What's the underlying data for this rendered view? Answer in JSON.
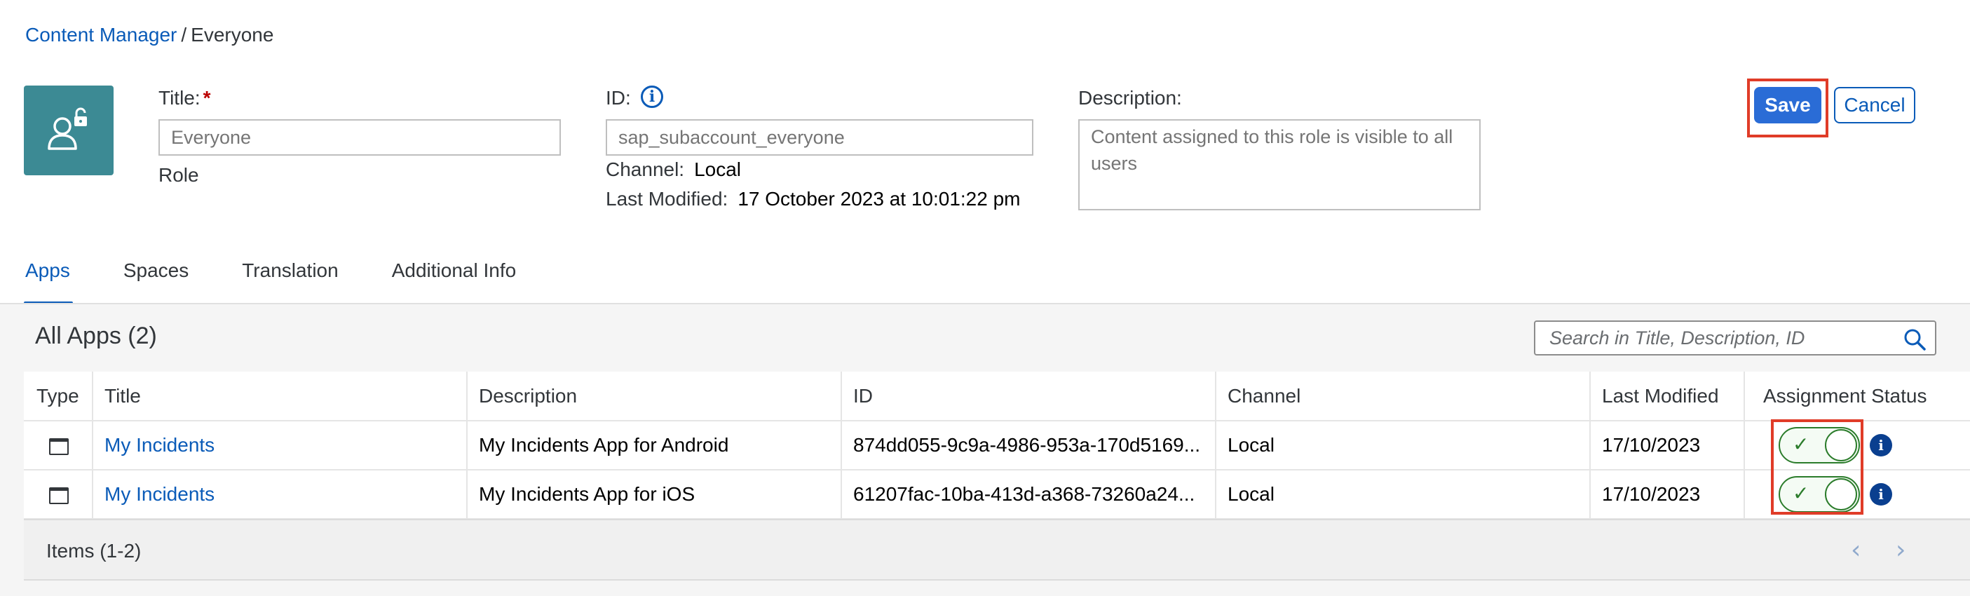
{
  "breadcrumb": {
    "root": "Content Manager",
    "separator": "/",
    "current": "Everyone"
  },
  "header": {
    "icon": "role-lock-user-icon",
    "icon_color": "#3c8a94",
    "type_label": "Role",
    "title_label": "Title:",
    "title_required": "*",
    "title_placeholder": "Everyone",
    "id_label": "ID:",
    "id_placeholder": "sap_subaccount_everyone",
    "channel_label": "Channel:",
    "channel_value": "Local",
    "last_modified_label": "Last Modified:",
    "last_modified_value": "17 October 2023 at 10:01:22 pm",
    "description_label": "Description:",
    "description_placeholder": "Content assigned to this role is visible to all users"
  },
  "toolbar": {
    "save_label": "Save",
    "cancel_label": "Cancel",
    "save_color": "#2a6cd6",
    "highlight_color": "#e03c28"
  },
  "tabs": [
    {
      "label": "Apps",
      "active": true
    },
    {
      "label": "Spaces",
      "active": false
    },
    {
      "label": "Translation",
      "active": false
    },
    {
      "label": "Additional Info",
      "active": false
    }
  ],
  "apps_section": {
    "heading": "All Apps (2)",
    "search_placeholder": "Search in Title, Description, ID",
    "columns": [
      "Type",
      "Title",
      "Description",
      "ID",
      "Channel",
      "Last Modified",
      "Assignment Status"
    ],
    "rows": [
      {
        "type_icon": "app-window-icon",
        "title": "My Incidents",
        "description": "My Incidents App for Android",
        "id": "874dd055-9c9a-4986-953a-170d5169...",
        "channel": "Local",
        "last_modified": "17/10/2023",
        "assigned": true
      },
      {
        "type_icon": "app-window-icon",
        "title": "My Incidents",
        "description": "My Incidents App for iOS",
        "id": "61207fac-10ba-413d-a368-73260a24...",
        "channel": "Local",
        "last_modified": "17/10/2023",
        "assigned": true
      }
    ],
    "footer_text": "Items (1-2)"
  },
  "colors": {
    "link": "#0a5bb8",
    "switch_on": "#2b7c2b"
  }
}
